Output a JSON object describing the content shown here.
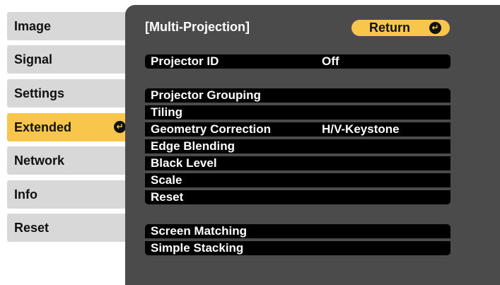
{
  "sidebar": {
    "items": [
      {
        "label": "Image"
      },
      {
        "label": "Signal"
      },
      {
        "label": "Settings"
      },
      {
        "label": "Extended"
      },
      {
        "label": "Network"
      },
      {
        "label": "Info"
      },
      {
        "label": "Reset"
      }
    ],
    "active_index": 3
  },
  "panel": {
    "title": "[Multi-Projection]",
    "return_label": "Return"
  },
  "menu": {
    "projector_id": {
      "label": "Projector ID",
      "value": "Off"
    },
    "projector_grouping": {
      "label": "Projector Grouping"
    },
    "tiling": {
      "label": "Tiling"
    },
    "geometry_correction": {
      "label": "Geometry Correction",
      "value": "H/V-Keystone"
    },
    "edge_blending": {
      "label": "Edge Blending"
    },
    "black_level": {
      "label": "Black Level"
    },
    "scale": {
      "label": "Scale"
    },
    "reset": {
      "label": "Reset"
    },
    "screen_matching": {
      "label": "Screen Matching"
    },
    "simple_stacking": {
      "label": "Simple Stacking"
    }
  },
  "icons": {
    "enter": "enter-return-icon"
  },
  "colors": {
    "highlight": "#f7c64a",
    "panel_bg": "#4b4b4b",
    "row_bg": "#000000",
    "tab_bg": "#d8d8d8"
  }
}
